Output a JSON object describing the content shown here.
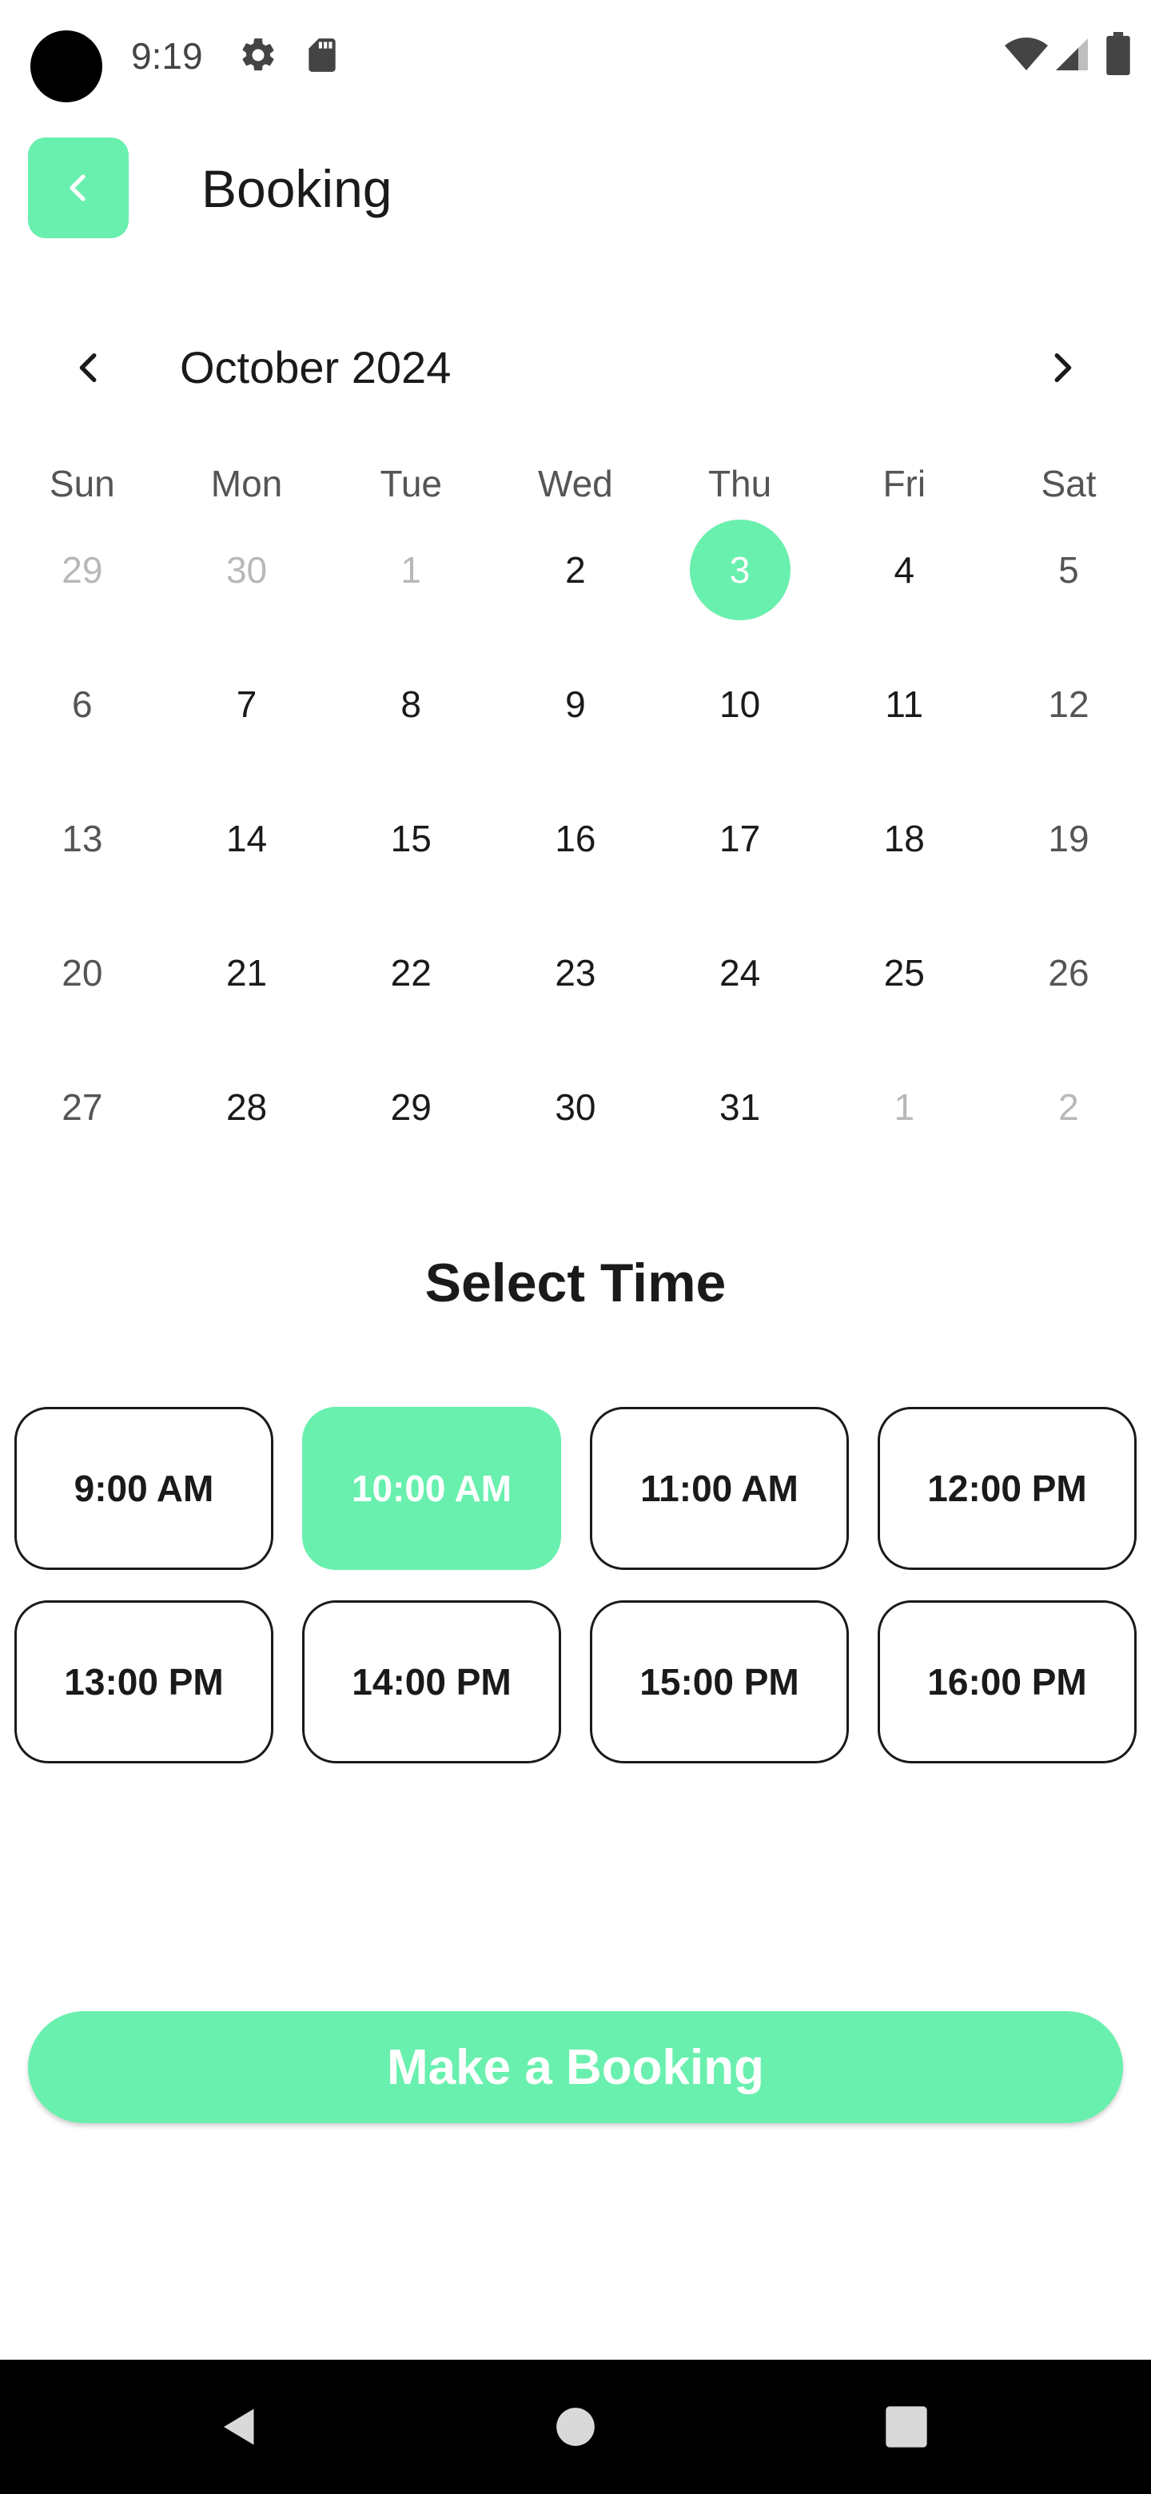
{
  "status_bar": {
    "time": "9:19",
    "icons": [
      "settings-gear-icon",
      "sd-card-icon",
      "wifi-icon",
      "cell-signal-icon",
      "battery-icon"
    ]
  },
  "header": {
    "title": "Booking",
    "back_icon": "chevron-left-icon"
  },
  "calendar": {
    "month_label": "October 2024",
    "prev_icon": "chevron-left-icon",
    "next_icon": "chevron-right-icon",
    "weekdays": [
      "Sun",
      "Mon",
      "Tue",
      "Wed",
      "Thu",
      "Fri",
      "Sat"
    ],
    "days": [
      {
        "label": "29",
        "outside": true
      },
      {
        "label": "30",
        "outside": true
      },
      {
        "label": "1",
        "outside": true
      },
      {
        "label": "2"
      },
      {
        "label": "3",
        "selected": true
      },
      {
        "label": "4"
      },
      {
        "label": "5"
      },
      {
        "label": "6"
      },
      {
        "label": "7"
      },
      {
        "label": "8"
      },
      {
        "label": "9"
      },
      {
        "label": "10"
      },
      {
        "label": "11"
      },
      {
        "label": "12"
      },
      {
        "label": "13"
      },
      {
        "label": "14"
      },
      {
        "label": "15"
      },
      {
        "label": "16"
      },
      {
        "label": "17"
      },
      {
        "label": "18"
      },
      {
        "label": "19"
      },
      {
        "label": "20"
      },
      {
        "label": "21"
      },
      {
        "label": "22"
      },
      {
        "label": "23"
      },
      {
        "label": "24"
      },
      {
        "label": "25"
      },
      {
        "label": "26"
      },
      {
        "label": "27"
      },
      {
        "label": "28"
      },
      {
        "label": "29"
      },
      {
        "label": "30"
      },
      {
        "label": "31"
      },
      {
        "label": "1",
        "outside": true
      },
      {
        "label": "2",
        "outside": true
      }
    ]
  },
  "time_section": {
    "title": "Select  Time",
    "slots": [
      {
        "label": "9:00 AM"
      },
      {
        "label": "10:00 AM",
        "selected": true
      },
      {
        "label": "11:00 AM"
      },
      {
        "label": "12:00 PM"
      },
      {
        "label": "13:00 PM"
      },
      {
        "label": "14:00 PM"
      },
      {
        "label": "15:00 PM"
      },
      {
        "label": "16:00 PM"
      }
    ]
  },
  "actions": {
    "booking_button_label": "Make a Booking"
  },
  "nav_bar": {
    "icons": [
      "nav-back-icon",
      "nav-home-icon",
      "nav-recents-icon"
    ]
  },
  "colors": {
    "accent": "#69f0ae",
    "text": "#1a1a1a",
    "muted": "#b8b8b8",
    "nav_bg": "#000000"
  }
}
